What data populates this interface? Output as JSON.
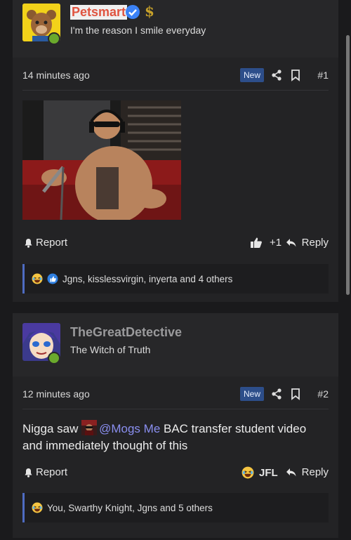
{
  "colors": {
    "accent": "#4e6bc2",
    "online": "#6aa92c",
    "new_badge": "#2d4e8a",
    "mention": "#8a8ff0"
  },
  "posts": [
    {
      "username": "Petsmart",
      "username_color": "#e05440",
      "user_title": "I'm the reason I smile everyday",
      "time": "14 minutes ago",
      "badge": "New",
      "post_number": "#1",
      "report_label": "Report",
      "reaction_count": "+1",
      "reply_label": "Reply",
      "reactions_summary": "Jgns, kisslessvirgin, inyerta and 4 others"
    },
    {
      "username": "TheGreatDetective",
      "username_color": "#9a9a9c",
      "user_title": "The Witch of Truth",
      "time": "12 minutes ago",
      "badge": "New",
      "post_number": "#2",
      "message_part1": "Nigga saw ",
      "mention": "@Mogs Me",
      "message_part2": " BAC transfer student video and immediately thought of this",
      "report_label": "Report",
      "reaction_label": "JFL",
      "reply_label": "Reply",
      "reactions_summary": "You, Swarthy Knight, Jgns and 5 others"
    }
  ]
}
